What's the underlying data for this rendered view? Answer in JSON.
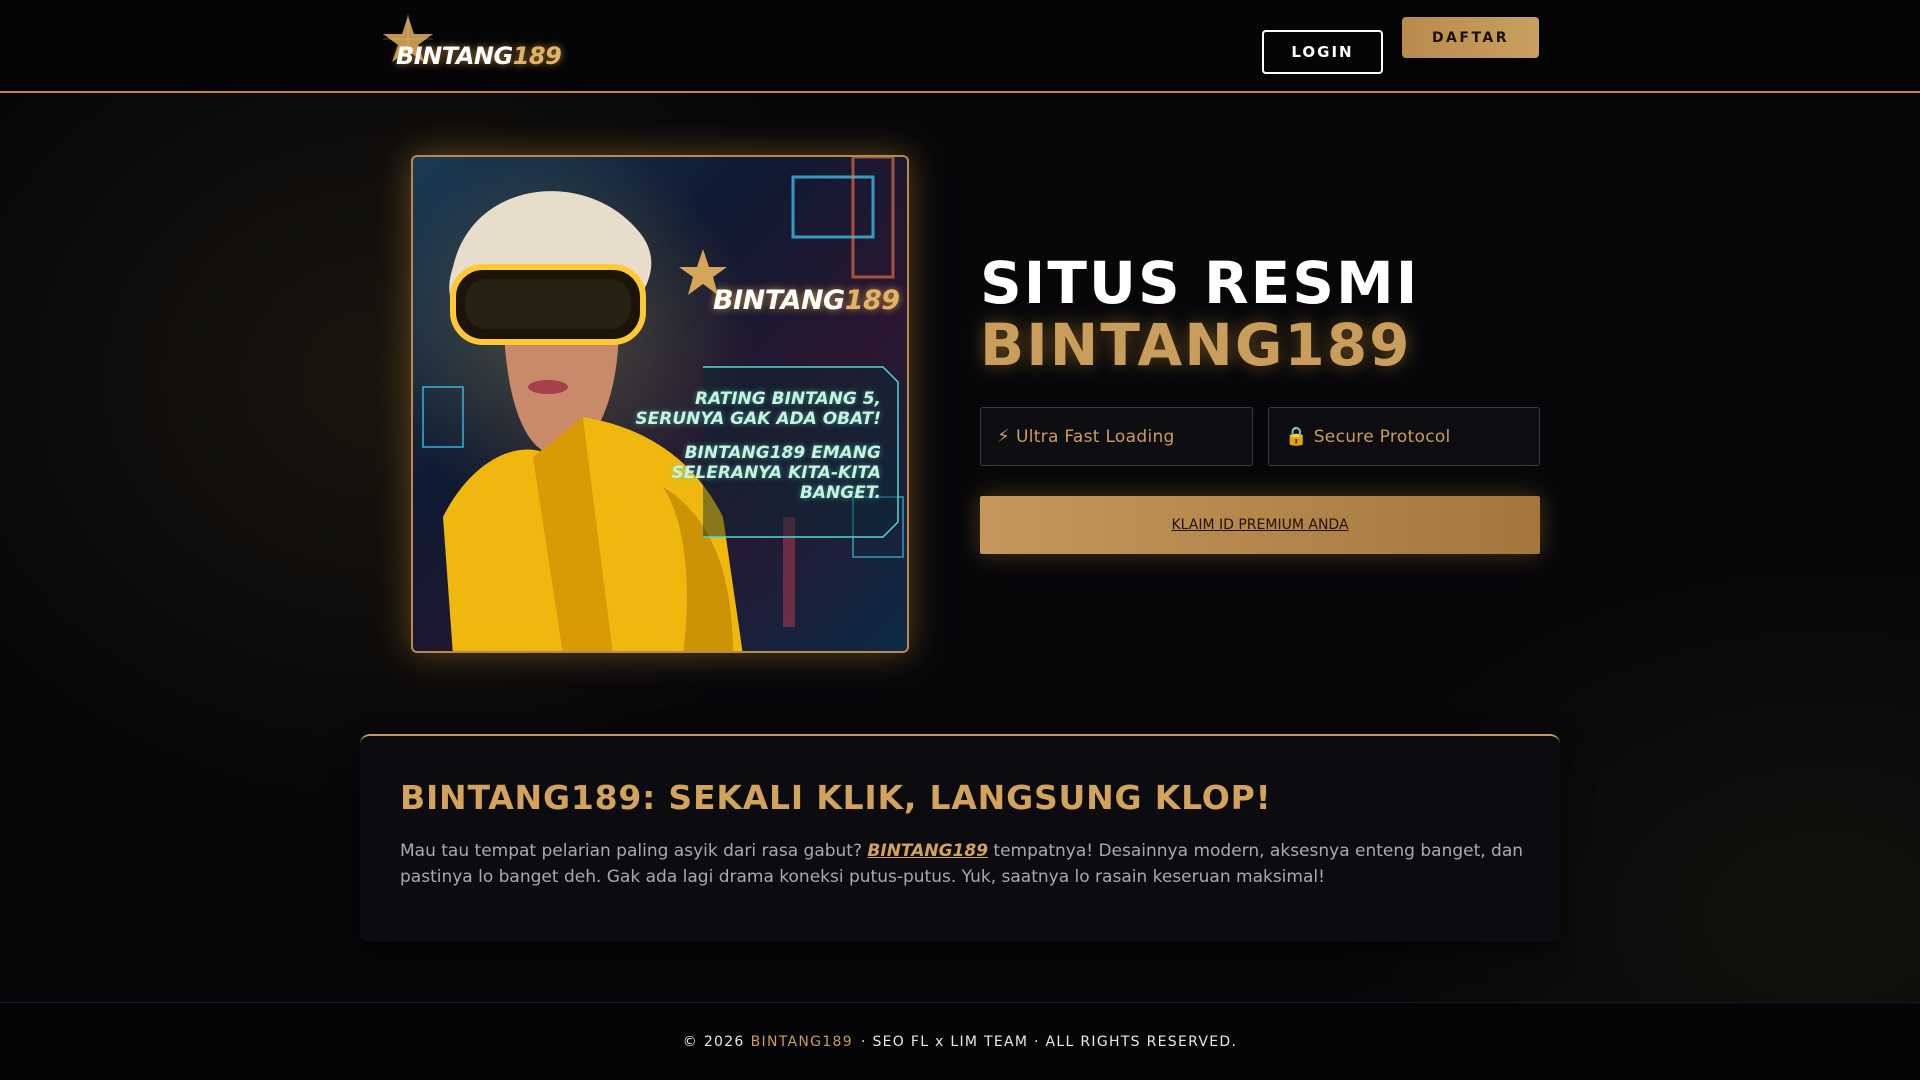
{
  "header": {
    "logo_text": "BINTANG",
    "logo_number": "189",
    "login_label": "LOGIN",
    "register_label": "DAFTAR"
  },
  "hero": {
    "image": {
      "logo_text": "BINTANG",
      "logo_number": "189",
      "caption_line1": "RATING BINTANG 5, SERUNYA GAK ADA OBAT!",
      "caption_line2": "BINTANG189 EMANG SELERANYA KITA-KITA BANGET."
    },
    "title_line1": "SITUS RESMI",
    "title_line2": "BINTANG189",
    "features": [
      {
        "icon": "lightning-icon",
        "glyph": "⚡",
        "label": "Ultra Fast Loading"
      },
      {
        "icon": "lock-icon",
        "glyph": "🔒",
        "label": "Secure Protocol"
      }
    ],
    "cta_label": "KLAIM ID PREMIUM ANDA"
  },
  "content": {
    "title": "BINTANG189: SEKALI KLIK, LANGSUNG KLOP!",
    "text_before": "Mau tau tempat pelarian paling asyik dari rasa gabut? ",
    "brand_link": "BINTANG189",
    "text_after": " tempatnya! Desainnya modern, aksesnya enteng banget, dan pastinya lo banget deh. Gak ada lagi drama koneksi putus-putus. Yuk, saatnya lo rasain keseruan maksimal!"
  },
  "footer": {
    "prefix": "© 2026",
    "brand": "BINTANG189",
    "suffix": "· SEO FL x LIM TEAM · ALL RIGHTS RESERVED."
  },
  "colors": {
    "accent_gold": "#c99d5b",
    "background": "#07070a",
    "header_border": "#b8894a"
  }
}
